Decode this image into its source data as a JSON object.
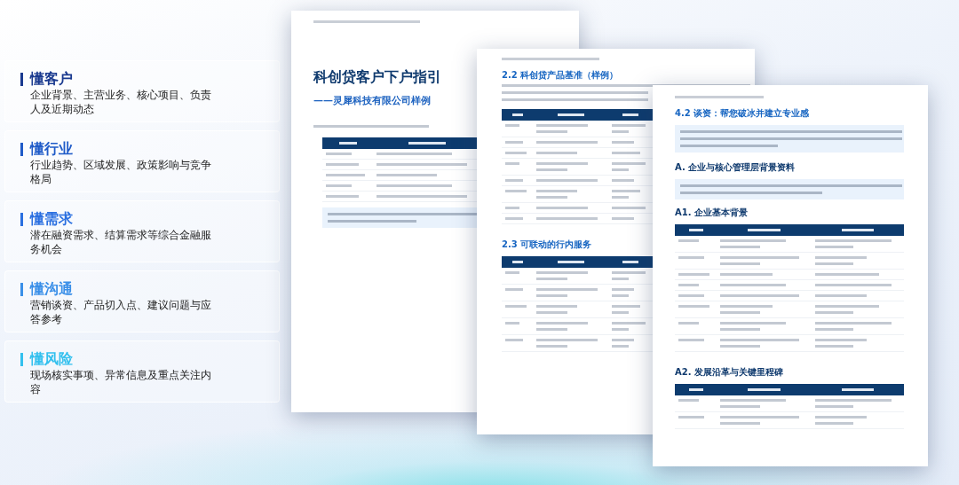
{
  "features": [
    {
      "title": "懂客户",
      "description": "企业背景、主营业务、核心项目、负责人及近期动态",
      "color": "#1a3a8f"
    },
    {
      "title": "懂行业",
      "description": "行业趋势、区域发展、政策影响与竞争格局",
      "color": "#1f5bc8"
    },
    {
      "title": "懂需求",
      "description": "潜在融资需求、结算需求等综合金融服务机会",
      "color": "#2a6fe0"
    },
    {
      "title": "懂沟通",
      "description": "营销谈资、产品切入点、建议问题与应答参考",
      "color": "#3a8fe8"
    },
    {
      "title": "懂风险",
      "description": "现场核实事项、异常信息及重点关注内容",
      "color": "#33c0ee"
    }
  ],
  "pages": [
    {
      "headings": [
        {
          "kind": "title",
          "text": "科创贷客户下户指引"
        },
        {
          "kind": "subtitle",
          "text": "——灵犀科技有限公司样例"
        }
      ]
    },
    {
      "headings": [
        {
          "kind": "section",
          "text": "2.2 科创贷产品基准（样例）"
        },
        {
          "kind": "section",
          "text": "2.3 可联动的行内服务"
        }
      ]
    },
    {
      "headings": [
        {
          "kind": "section",
          "text": "4.2 谈资：帮您破冰并建立专业感"
        },
        {
          "kind": "sub",
          "text": "A. 企业与核心管理层背景资料"
        },
        {
          "kind": "sub",
          "text": "A1. 企业基本背景"
        },
        {
          "kind": "sub",
          "text": "A2. 发展沿革与关键里程碑"
        }
      ]
    }
  ]
}
